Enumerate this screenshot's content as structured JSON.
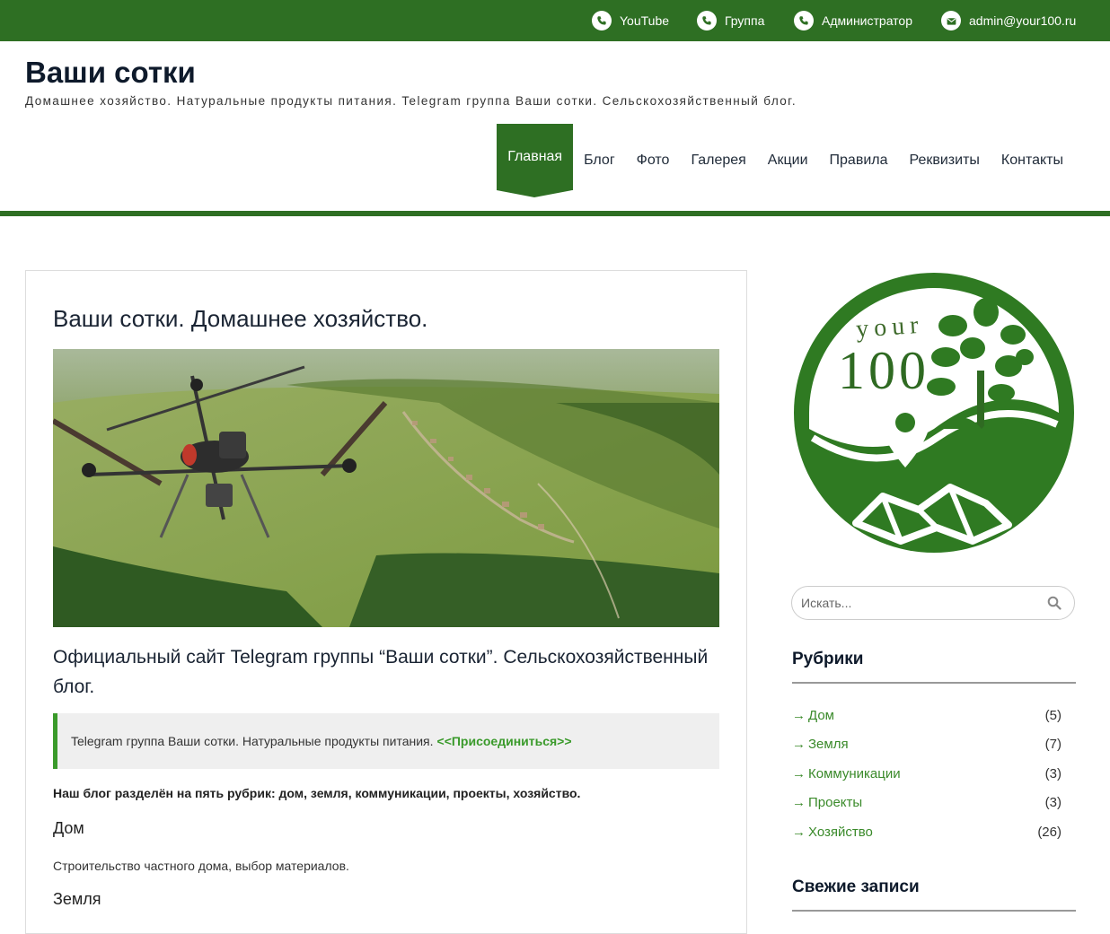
{
  "topbar": {
    "items": [
      {
        "icon": "phone-icon",
        "label": "YouTube"
      },
      {
        "icon": "phone-icon",
        "label": "Группа"
      },
      {
        "icon": "phone-icon",
        "label": "Администратор"
      },
      {
        "icon": "envelope-icon",
        "label": "admin@your100.ru"
      }
    ],
    "color": "#2e6f23"
  },
  "header": {
    "title": "Ваши сотки",
    "description": "Домашнее хозяйство. Натуральные продукты питания. Telegram группа Ваши сотки. Сельскохозяйственный блог."
  },
  "nav": {
    "items": [
      {
        "label": "Главная",
        "active": true
      },
      {
        "label": "Блог"
      },
      {
        "label": "Фото"
      },
      {
        "label": "Галерея"
      },
      {
        "label": "Акции"
      },
      {
        "label": "Правила"
      },
      {
        "label": "Реквизиты"
      },
      {
        "label": "Контакты"
      }
    ]
  },
  "post": {
    "title": "Ваши сотки. Домашнее хозяйство.",
    "lead": "Официальный сайт Telegram группы “Ваши сотки”. Сельскохозяйственный блог.",
    "quote_text": "Telegram группа Ваши сотки. Натуральные продукты питания.",
    "quote_link": "<<Присоединиться>>",
    "intro": "Наш блог разделён на пять рубрик: дом, земля, коммуникации, проекты, хозяйство.",
    "section1_title": "Дом",
    "section1_text": "Строительство частного дома, выбор материалов.",
    "section2_title": "Земля"
  },
  "sidebar": {
    "logo": {
      "word": "your",
      "number": "100"
    },
    "search_placeholder": "Искать...",
    "categories_title": "Рубрики",
    "categories": [
      {
        "label": "Дом",
        "count": "(5)"
      },
      {
        "label": "Земля",
        "count": "(7)"
      },
      {
        "label": "Коммуникации",
        "count": "(3)"
      },
      {
        "label": "Проекты",
        "count": "(3)"
      },
      {
        "label": "Хозяйство",
        "count": "(26)"
      }
    ],
    "recent_title": "Свежие записи"
  }
}
